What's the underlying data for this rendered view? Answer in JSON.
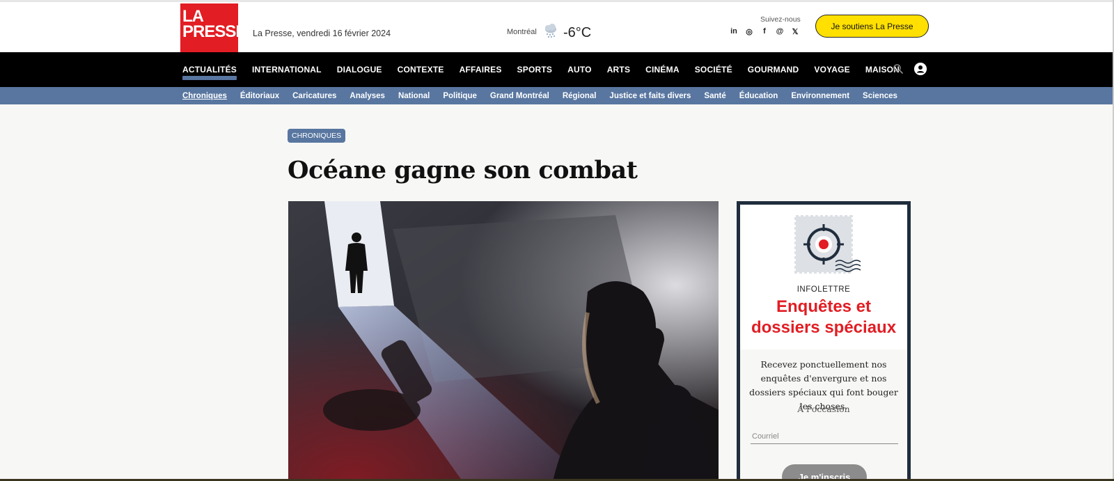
{
  "header": {
    "logo_line1": "LA",
    "logo_line2": "PRESSE",
    "date": "La Presse, vendredi 16 février 2024",
    "weather": {
      "city": "Montréal",
      "temperature": "-6°C",
      "icon": "snow-cloud-icon"
    },
    "follow_label": "Suivez-nous",
    "socials": [
      {
        "name": "linkedin",
        "glyph": "in"
      },
      {
        "name": "instagram",
        "glyph": "◎"
      },
      {
        "name": "facebook",
        "glyph": "f"
      },
      {
        "name": "threads",
        "glyph": "@"
      },
      {
        "name": "x",
        "glyph": "𝕏"
      }
    ],
    "support_button": "Je soutiens La Presse"
  },
  "main_nav": {
    "items": [
      "ACTUALITÉS",
      "INTERNATIONAL",
      "DIALOGUE",
      "CONTEXTE",
      "AFFAIRES",
      "SPORTS",
      "AUTO",
      "ARTS",
      "CINÉMA",
      "SOCIÉTÉ",
      "GOURMAND",
      "VOYAGE",
      "MAISON"
    ],
    "active_index": 0
  },
  "sub_nav": {
    "items": [
      "Chroniques",
      "Éditoriaux",
      "Caricatures",
      "Analyses",
      "National",
      "Politique",
      "Grand Montréal",
      "Régional",
      "Justice et faits divers",
      "Santé",
      "Éducation",
      "Environnement",
      "Sciences"
    ]
  },
  "article": {
    "section_badge": "CHRONIQUES",
    "headline": "Océane gagne son combat"
  },
  "newsletter": {
    "kicker": "INFOLETTRE",
    "title_line1": "Enquêtes et",
    "title_line2": "dossiers spéciaux",
    "description": "Recevez ponctuellement nos enquêtes d'envergure et nos dossiers spéciaux qui font bouger les choses.",
    "frequency": "À l'occasion",
    "email_placeholder": "Courriel",
    "subscribe_button": "Je m'inscris"
  },
  "colors": {
    "brand_red": "#e21d23",
    "nav_black": "#000000",
    "subnav_blue": "#5876a0",
    "support_yellow": "#ffe000",
    "newsletter_border": "#1f2d3d"
  }
}
